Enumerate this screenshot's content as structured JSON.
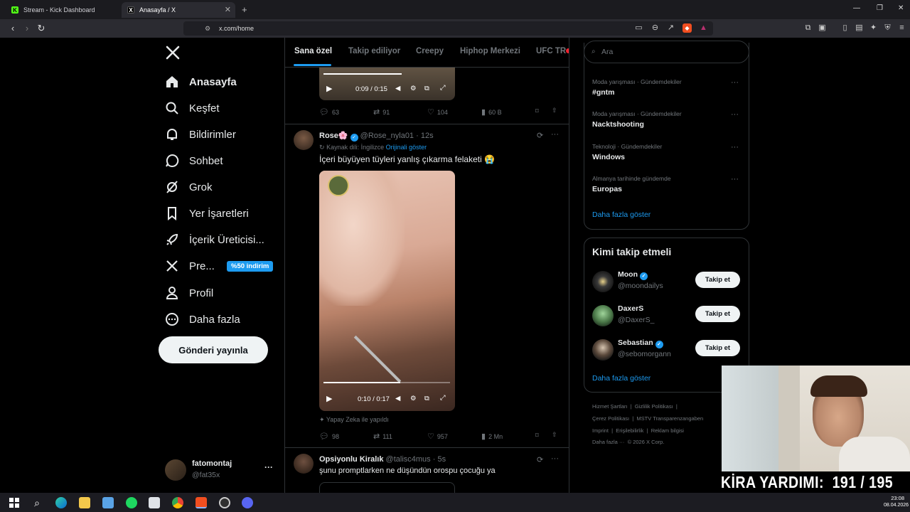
{
  "browser": {
    "tabs": [
      {
        "title": "Stream - Kick Dashboard",
        "icon": "kick-icon"
      },
      {
        "title": "Anasayfa / X",
        "icon": "x-logo-icon"
      }
    ],
    "url": "x.com/home",
    "window_controls": [
      "—",
      "❐",
      "✕"
    ]
  },
  "sidebar": {
    "items": [
      {
        "label": "Anasayfa",
        "icon": "home-icon"
      },
      {
        "label": "Keşfet",
        "icon": "search-icon"
      },
      {
        "label": "Bildirimler",
        "icon": "bell-icon"
      },
      {
        "label": "Sohbet",
        "icon": "chat-icon"
      },
      {
        "label": "Grok",
        "icon": "grok-icon"
      },
      {
        "label": "Yer İşaretleri",
        "icon": "bookmark-icon"
      },
      {
        "label": "İçerik Üreticisi...",
        "icon": "rocket-icon"
      },
      {
        "label": "Pre...",
        "icon": "x-logo-icon"
      },
      {
        "label": "Profil",
        "icon": "person-icon"
      },
      {
        "label": "Daha fazla",
        "icon": "more-circle-icon"
      }
    ],
    "premium_badge": "%50 indirim",
    "post_button": "Gönderi yayınla",
    "account": {
      "name": "fatomontaj",
      "handle": "@fat35x"
    }
  },
  "feed": {
    "tabs": [
      "Sana özel",
      "Takip ediliyor",
      "Creepy",
      "Hiphop Merkezi",
      "UFC TR"
    ],
    "tweet0": {
      "video_time": "0:09 / 0:15",
      "replies": "63",
      "reposts": "91",
      "likes": "104",
      "views": "60 B"
    },
    "tweet1": {
      "name": "Rose🌸",
      "handle": "@Rose_nyla01",
      "time": "12s",
      "translate_note": "Kaynak dili: İngilizce",
      "translate_link": "Orijinali göster",
      "text": "İçeri büyüyen tüyleri yanlış çıkarma felaketi 😭",
      "video_time": "0:10 / 0:17",
      "ai_note": "Yapay Zeka ile yapıldı",
      "replies": "98",
      "reposts": "111",
      "likes": "957",
      "views": "2 Mn"
    },
    "tweet2": {
      "name": "Opsiyonlu Kiralık",
      "handle": "@talisc4mus",
      "time": "5s",
      "text": "şunu promptlarken ne düşündün orospu çocuğu ya"
    },
    "separator": "·"
  },
  "right": {
    "search_placeholder": "Ara",
    "trends": [
      {
        "meta": "Moda yarışması · Gündemdekiler",
        "name": "#gntm"
      },
      {
        "meta": "Moda yarışması · Gündemdekiler",
        "name": "Nacktshooting"
      },
      {
        "meta": "Teknoloji · Gündemdekiler",
        "name": "Windows"
      },
      {
        "meta": "Almanya tarihinde gündemde",
        "name": "Europas"
      }
    ],
    "trends_more": "Daha fazla göster",
    "who_title": "Kimi takip etmeli",
    "who": [
      {
        "name": "Moon",
        "handle": "@moondailys",
        "button": "Takip et",
        "verified": true
      },
      {
        "name": "DaxerS",
        "handle": "@DaxerS_",
        "button": "Takip et",
        "verified": false
      },
      {
        "name": "Sebastian",
        "handle": "@sebomorgann",
        "button": "Takip et",
        "verified": true
      }
    ],
    "who_more": "Daha fazla göster",
    "footer": {
      "l1a": "Hizmet Şartları",
      "l1b": "Gizlilik Politikası",
      "l2a": "Çerez Politikası",
      "l2b": "MSTV Transparenzangaben",
      "l3a": "Imprint",
      "l3b": "Erişilebilirlik",
      "l3c": "Reklam bilgisi",
      "l4a": "Daha fazla ···",
      "l4b": "© 2026 X Corp."
    }
  },
  "overlay": {
    "text": "KİRA YARDIMI:  191 / 195"
  },
  "taskbar": {
    "time": "23:08",
    "date": "08.04.2026"
  }
}
